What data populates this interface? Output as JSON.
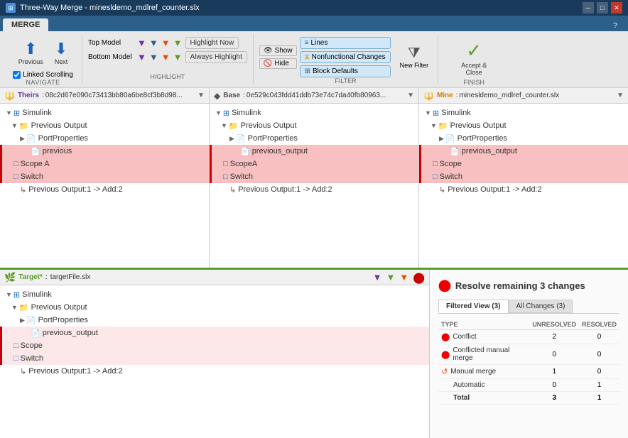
{
  "title_bar": {
    "title": "Three-Way Merge - minesldemo_mdlref_counter.slx",
    "icon": "⊞"
  },
  "tab": {
    "label": "MERGE"
  },
  "toolbar": {
    "navigate": {
      "label": "NAVIGATE",
      "prev_label": "Previous",
      "next_label": "Next",
      "linked_scrolling": "Linked Scrolling"
    },
    "highlight": {
      "label": "HIGHLIGHT",
      "top_model": "Top Model",
      "bottom_model": "Bottom Model",
      "highlight_now": "Highlight Now",
      "always_highlight": "Always Highlight"
    },
    "filter": {
      "label": "FILTER",
      "show": "Show",
      "hide": "Hide",
      "lines": "Lines",
      "nonfunctional": "Nonfunctional Changes",
      "block_defaults": "Block Defaults",
      "new_filter": "New Filter"
    },
    "finish": {
      "label": "FINISH",
      "accept_close": "Accept &\nClose"
    }
  },
  "panels": {
    "theirs": {
      "label": "Theirs",
      "value": "08c2d67e090c73413bb80a6be8cf3b8d98..."
    },
    "base": {
      "label": "Base",
      "value": "0e529c043fdd41ddb73e74c7da40fb80963..."
    },
    "mine": {
      "label": "Mine",
      "value": "minesldemo_mdlref_counter.slx"
    }
  },
  "theirs_tree": [
    {
      "label": "Simulink",
      "level": 0,
      "icon": "folder",
      "expanded": true,
      "highlighted": false
    },
    {
      "label": "Previous Output",
      "level": 1,
      "icon": "folder",
      "expanded": true,
      "highlighted": false
    },
    {
      "label": "PortProperties",
      "level": 2,
      "icon": "file",
      "highlighted": false
    },
    {
      "label": "previous",
      "level": 3,
      "icon": "file",
      "highlighted": true
    },
    {
      "label": "Scope A",
      "level": 1,
      "icon": "block",
      "highlighted": true
    },
    {
      "label": "Switch",
      "level": 1,
      "icon": "block",
      "highlighted": true
    },
    {
      "label": "Previous Output:1 -> Add:2",
      "level": 2,
      "icon": "arrow",
      "highlighted": false
    }
  ],
  "base_tree": [
    {
      "label": "Simulink",
      "level": 0,
      "icon": "folder",
      "expanded": true,
      "highlighted": false
    },
    {
      "label": "Previous Output",
      "level": 1,
      "icon": "folder",
      "expanded": true,
      "highlighted": false
    },
    {
      "label": "PortProperties",
      "level": 2,
      "icon": "file",
      "highlighted": false
    },
    {
      "label": "previous_output",
      "level": 3,
      "icon": "file",
      "highlighted": true
    },
    {
      "label": "ScopeA",
      "level": 1,
      "icon": "block",
      "highlighted": true
    },
    {
      "label": "Switch",
      "level": 1,
      "icon": "block",
      "highlighted": true
    },
    {
      "label": "Previous Output:1 -> Add:2",
      "level": 2,
      "icon": "arrow",
      "highlighted": false
    }
  ],
  "mine_tree": [
    {
      "label": "Simulink",
      "level": 0,
      "icon": "folder",
      "expanded": true,
      "highlighted": false
    },
    {
      "label": "Previous Output",
      "level": 1,
      "icon": "folder",
      "expanded": true,
      "highlighted": false
    },
    {
      "label": "PortProperties",
      "level": 2,
      "icon": "file",
      "highlighted": false
    },
    {
      "label": "previous_output",
      "level": 3,
      "icon": "file",
      "highlighted": true
    },
    {
      "label": "Scope",
      "level": 1,
      "icon": "block",
      "highlighted": true
    },
    {
      "label": "Switch",
      "level": 1,
      "icon": "block",
      "highlighted": true
    },
    {
      "label": "Previous Output:1 -> Add:2",
      "level": 2,
      "icon": "arrow",
      "highlighted": false
    }
  ],
  "target": {
    "label": "Target*",
    "value": "targetFile.slx",
    "tree": [
      {
        "label": "Simulink",
        "level": 0,
        "icon": "folder",
        "expanded": true,
        "highlighted": false
      },
      {
        "label": "Previous Output",
        "level": 1,
        "icon": "folder",
        "expanded": true,
        "highlighted": false
      },
      {
        "label": "PortProperties",
        "level": 2,
        "icon": "file",
        "highlighted": false
      },
      {
        "label": "previous_output",
        "level": 3,
        "icon": "file",
        "highlighted": true
      },
      {
        "label": "Scope",
        "level": 1,
        "icon": "block",
        "highlighted": true
      },
      {
        "label": "Switch",
        "level": 1,
        "icon": "block",
        "highlighted": true
      },
      {
        "label": "Previous Output:1 -> Add:2",
        "level": 2,
        "icon": "arrow",
        "highlighted": false
      }
    ]
  },
  "resolve": {
    "title": "Resolve remaining 3 changes",
    "tab_filtered": "Filtered View (3)",
    "tab_all": "All Changes (3)",
    "columns": {
      "type": "TYPE",
      "unresolved": "UNRESOLVED",
      "resolved": "RESOLVED"
    },
    "rows": [
      {
        "type": "Conflict",
        "icon": "conflict",
        "unresolved": 2,
        "resolved": 0
      },
      {
        "type": "Conflicted manual merge",
        "icon": "conflict",
        "unresolved": 0,
        "resolved": 0
      },
      {
        "type": "Manual merge",
        "icon": "manual",
        "unresolved": 1,
        "resolved": 0
      },
      {
        "type": "Automatic",
        "icon": "none",
        "unresolved": 0,
        "resolved": 1
      },
      {
        "type": "Total",
        "icon": "none",
        "unresolved": 3,
        "resolved": 1
      }
    ]
  }
}
